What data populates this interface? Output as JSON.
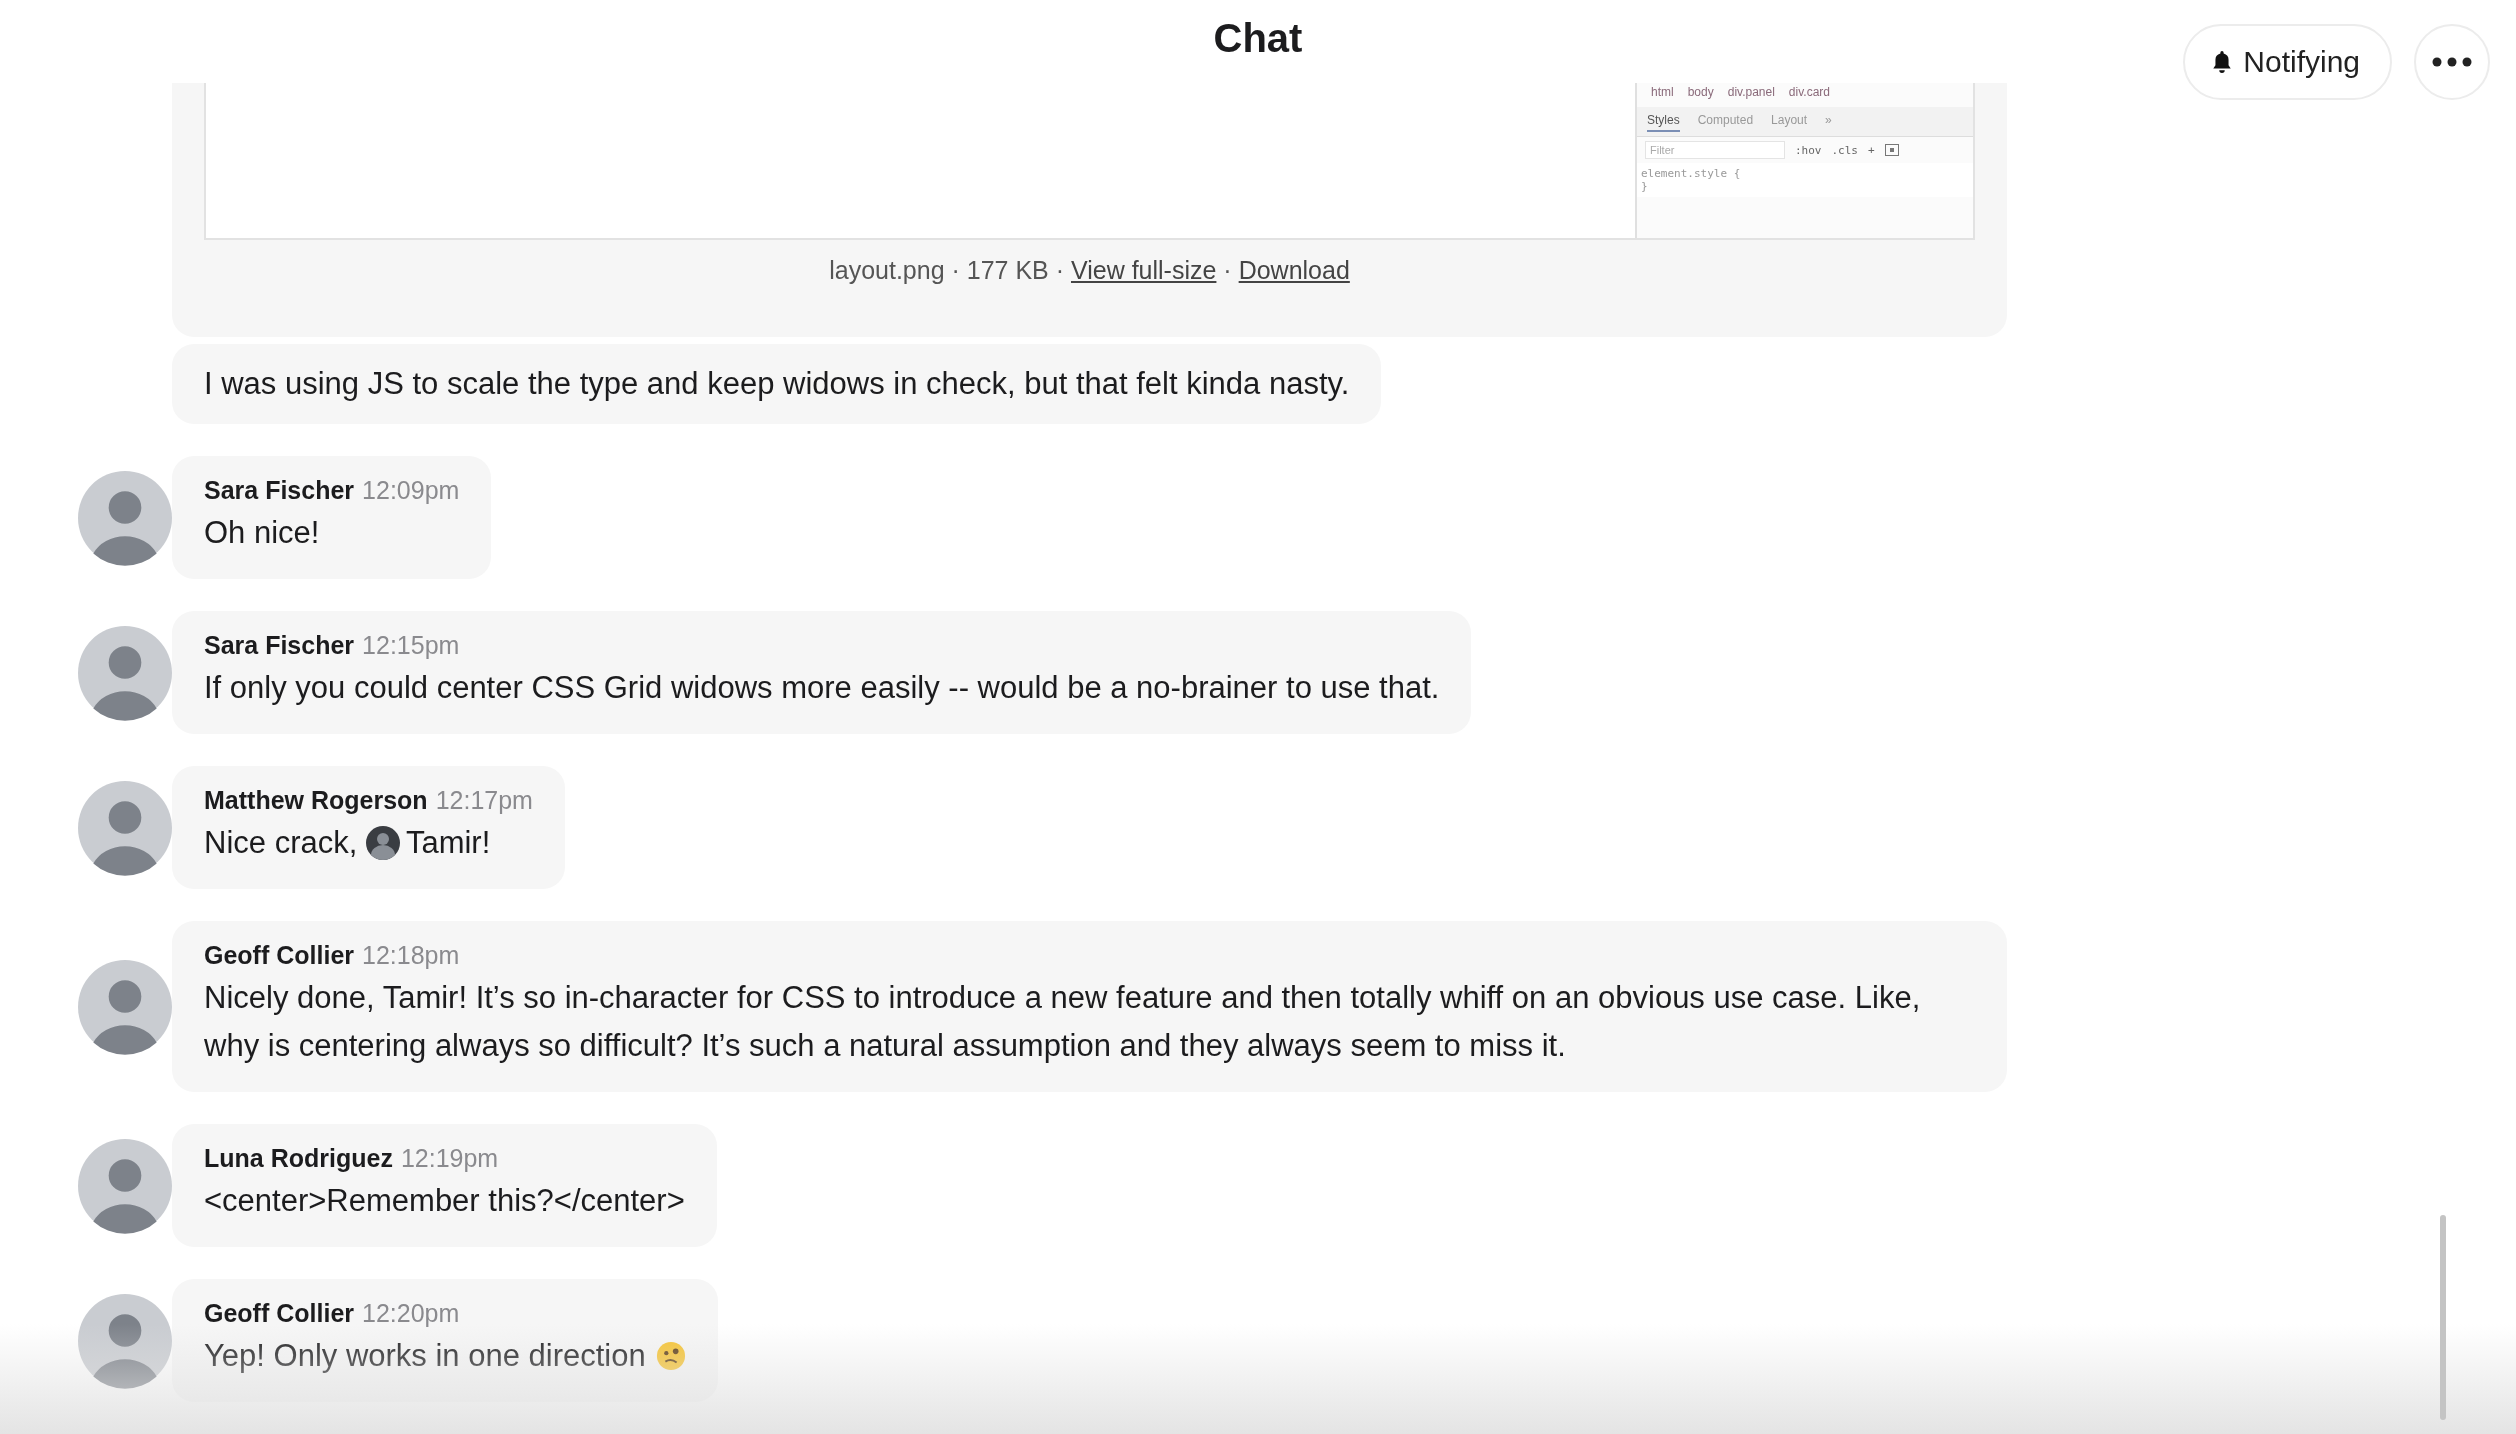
{
  "header": {
    "title": "Chat",
    "notify_button": "Notifying"
  },
  "messages": [
    {
      "kind": "attachment",
      "devtools": {
        "breadcrumbs": [
          "html",
          "body",
          "div.panel",
          "div.card"
        ],
        "tabs": [
          {
            "label": "Styles",
            "selected": true
          },
          {
            "label": "Computed",
            "selected": false
          },
          {
            "label": "Layout",
            "selected": false
          },
          {
            "label": "»",
            "selected": false
          }
        ],
        "filter_placeholder": "Filter",
        "tools": [
          ":hov",
          ".cls",
          "+"
        ],
        "code": [
          "element.style {",
          "}"
        ]
      },
      "caption": {
        "file": "layout.png · 177 KB · ",
        "links": [
          "View full-size",
          "Download"
        ],
        "separator": " · "
      }
    },
    {
      "kind": "text",
      "segments": [
        {
          "kind": "text",
          "text": "I was using JS to scale the type and keep widows in check, but that felt kinda nasty."
        }
      ]
    },
    {
      "kind": "post",
      "author": "Sara Fischer",
      "time": "12:09pm",
      "segments": [
        {
          "kind": "text",
          "text": "Oh nice!"
        }
      ]
    },
    {
      "kind": "post",
      "author": "Sara Fischer",
      "time": "12:15pm",
      "segments": [
        {
          "kind": "text",
          "text": "If only you could center CSS Grid widows more easily -- would be a no-brainer to use that."
        }
      ]
    },
    {
      "kind": "post",
      "author": "Matthew Rogerson",
      "time": "12:17pm",
      "segments": [
        {
          "kind": "text",
          "text": "Nice crack, "
        },
        {
          "kind": "mention",
          "text": "Tamir!"
        }
      ]
    },
    {
      "kind": "post",
      "author": "Geoff Collier",
      "time": "12:18pm",
      "segments": [
        {
          "kind": "text",
          "text": "Nicely done, Tamir! It’s so in-character for CSS to introduce a new feature and then totally whiff on an obvious use case. Like, why is centering always so difficult? It’s such a natural assumption and they always seem to miss it."
        }
      ]
    },
    {
      "kind": "post",
      "author": "Luna Rodriguez",
      "time": "12:19pm",
      "segments": [
        {
          "kind": "text",
          "text": "<center>Remember this?</center>"
        }
      ]
    },
    {
      "kind": "post",
      "author": "Geoff Collier",
      "time": "12:20pm",
      "segments": [
        {
          "kind": "text",
          "text": "Yep! Only works in one direction "
        },
        {
          "kind": "emoji"
        }
      ]
    }
  ]
}
